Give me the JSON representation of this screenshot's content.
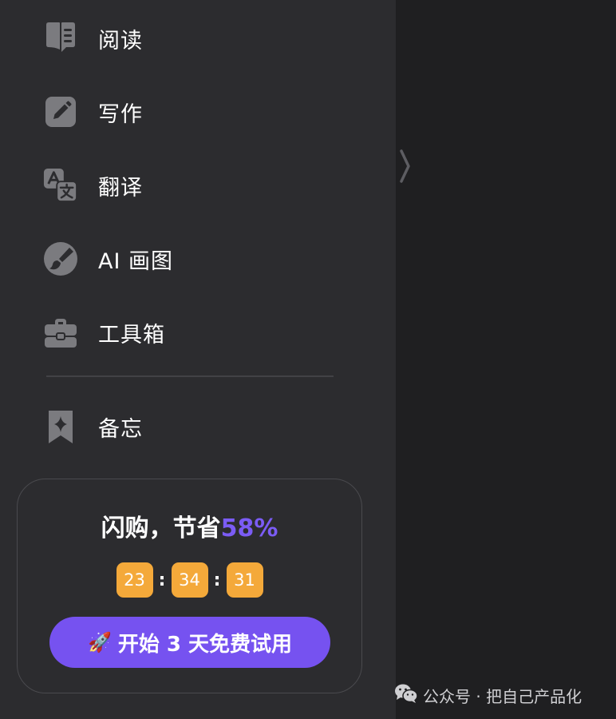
{
  "sidebar": {
    "items": [
      {
        "label": "阅读",
        "icon": "book-icon"
      },
      {
        "label": "写作",
        "icon": "pencil-icon"
      },
      {
        "label": "翻译",
        "icon": "translate-icon"
      },
      {
        "label": "AI 画图",
        "icon": "paint-brush-icon"
      },
      {
        "label": "工具箱",
        "icon": "toolbox-icon"
      },
      {
        "label": "备忘",
        "icon": "bookmark-star-icon"
      }
    ]
  },
  "promo": {
    "title_prefix": "闪购，节省",
    "discount": "58%",
    "countdown": {
      "hours": "23",
      "minutes": "34",
      "seconds": "31",
      "separator": ":"
    },
    "cta_icon": "🚀",
    "cta_label": "开始 3 天免费试用"
  },
  "watermark": {
    "text": "公众号 · 把自己产品化",
    "icon": "wechat-icon"
  },
  "colors": {
    "sidebar_bg": "#2c2c2f",
    "main_bg": "#1f1f21",
    "accent_purple": "#7652f0",
    "countdown_orange": "#f4a93a",
    "icon_gray": "#7b7b7f"
  }
}
